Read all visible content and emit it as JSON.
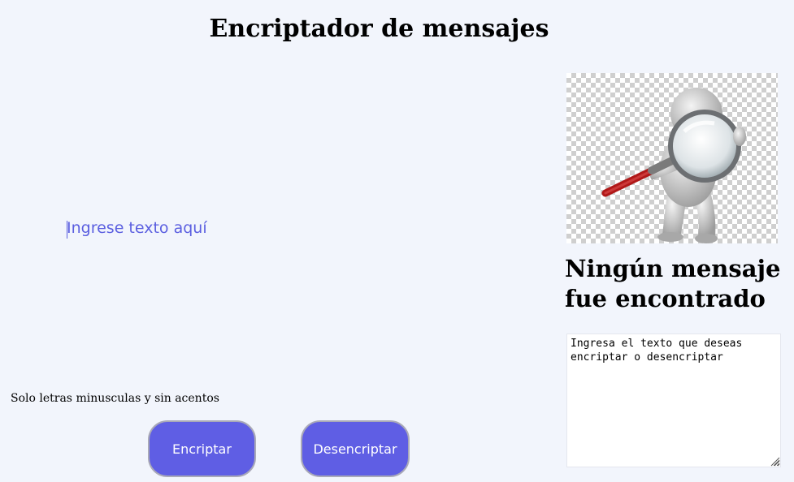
{
  "header": {
    "title": "Encriptador de mensajes"
  },
  "input": {
    "placeholder": "Ingrese texto aquí"
  },
  "hint": {
    "text": "Solo letras minusculas y sin acentos"
  },
  "buttons": {
    "encrypt_label": "Encriptar",
    "decrypt_label": "Desencriptar"
  },
  "result_panel": {
    "image_icon": "person-with-magnifying-glass",
    "title": "Ningún mensaje fue encontrado",
    "output_text": "Ingresa el texto que deseas encriptar o desencriptar"
  },
  "colors": {
    "background": "#f2f5fc",
    "accent": "#5f5ee4",
    "placeholder": "#5b5fe0"
  }
}
